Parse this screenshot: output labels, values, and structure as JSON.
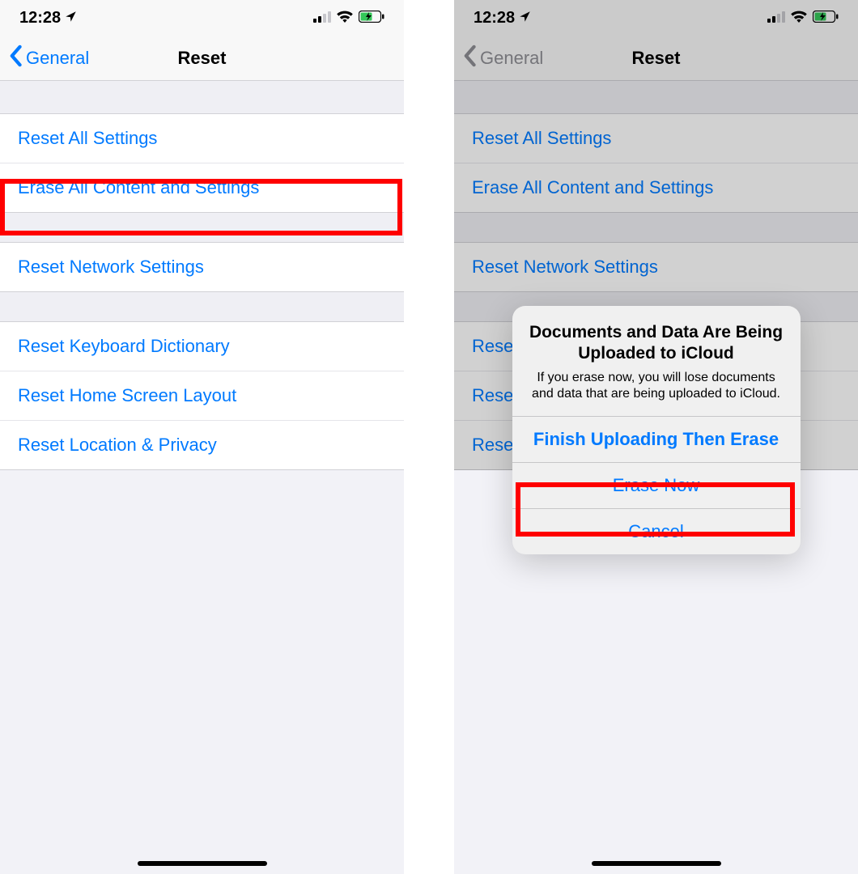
{
  "left": {
    "status": {
      "time": "12:28"
    },
    "nav": {
      "back": "General",
      "title": "Reset"
    },
    "rows": {
      "reset_all": "Reset All Settings",
      "erase_all": "Erase All Content and Settings",
      "reset_network": "Reset Network Settings",
      "reset_keyboard": "Reset Keyboard Dictionary",
      "reset_home": "Reset Home Screen Layout",
      "reset_location": "Reset Location & Privacy"
    }
  },
  "right": {
    "status": {
      "time": "12:28"
    },
    "nav": {
      "back": "General",
      "title": "Reset"
    },
    "rows": {
      "reset_all": "Reset All Settings",
      "erase_all": "Erase All Content and Settings",
      "reset_network": "Reset Network Settings",
      "reset_keyboard": "Rese",
      "reset_home": "Rese",
      "reset_location": "Rese"
    },
    "dialog": {
      "title": "Documents and Data Are Being Uploaded to iCloud",
      "message": "If you erase now, you will lose documents and data that are being uploaded to iCloud.",
      "btn_finish": "Finish Uploading Then Erase",
      "btn_erase": "Erase Now",
      "btn_cancel": "Cancel"
    }
  }
}
